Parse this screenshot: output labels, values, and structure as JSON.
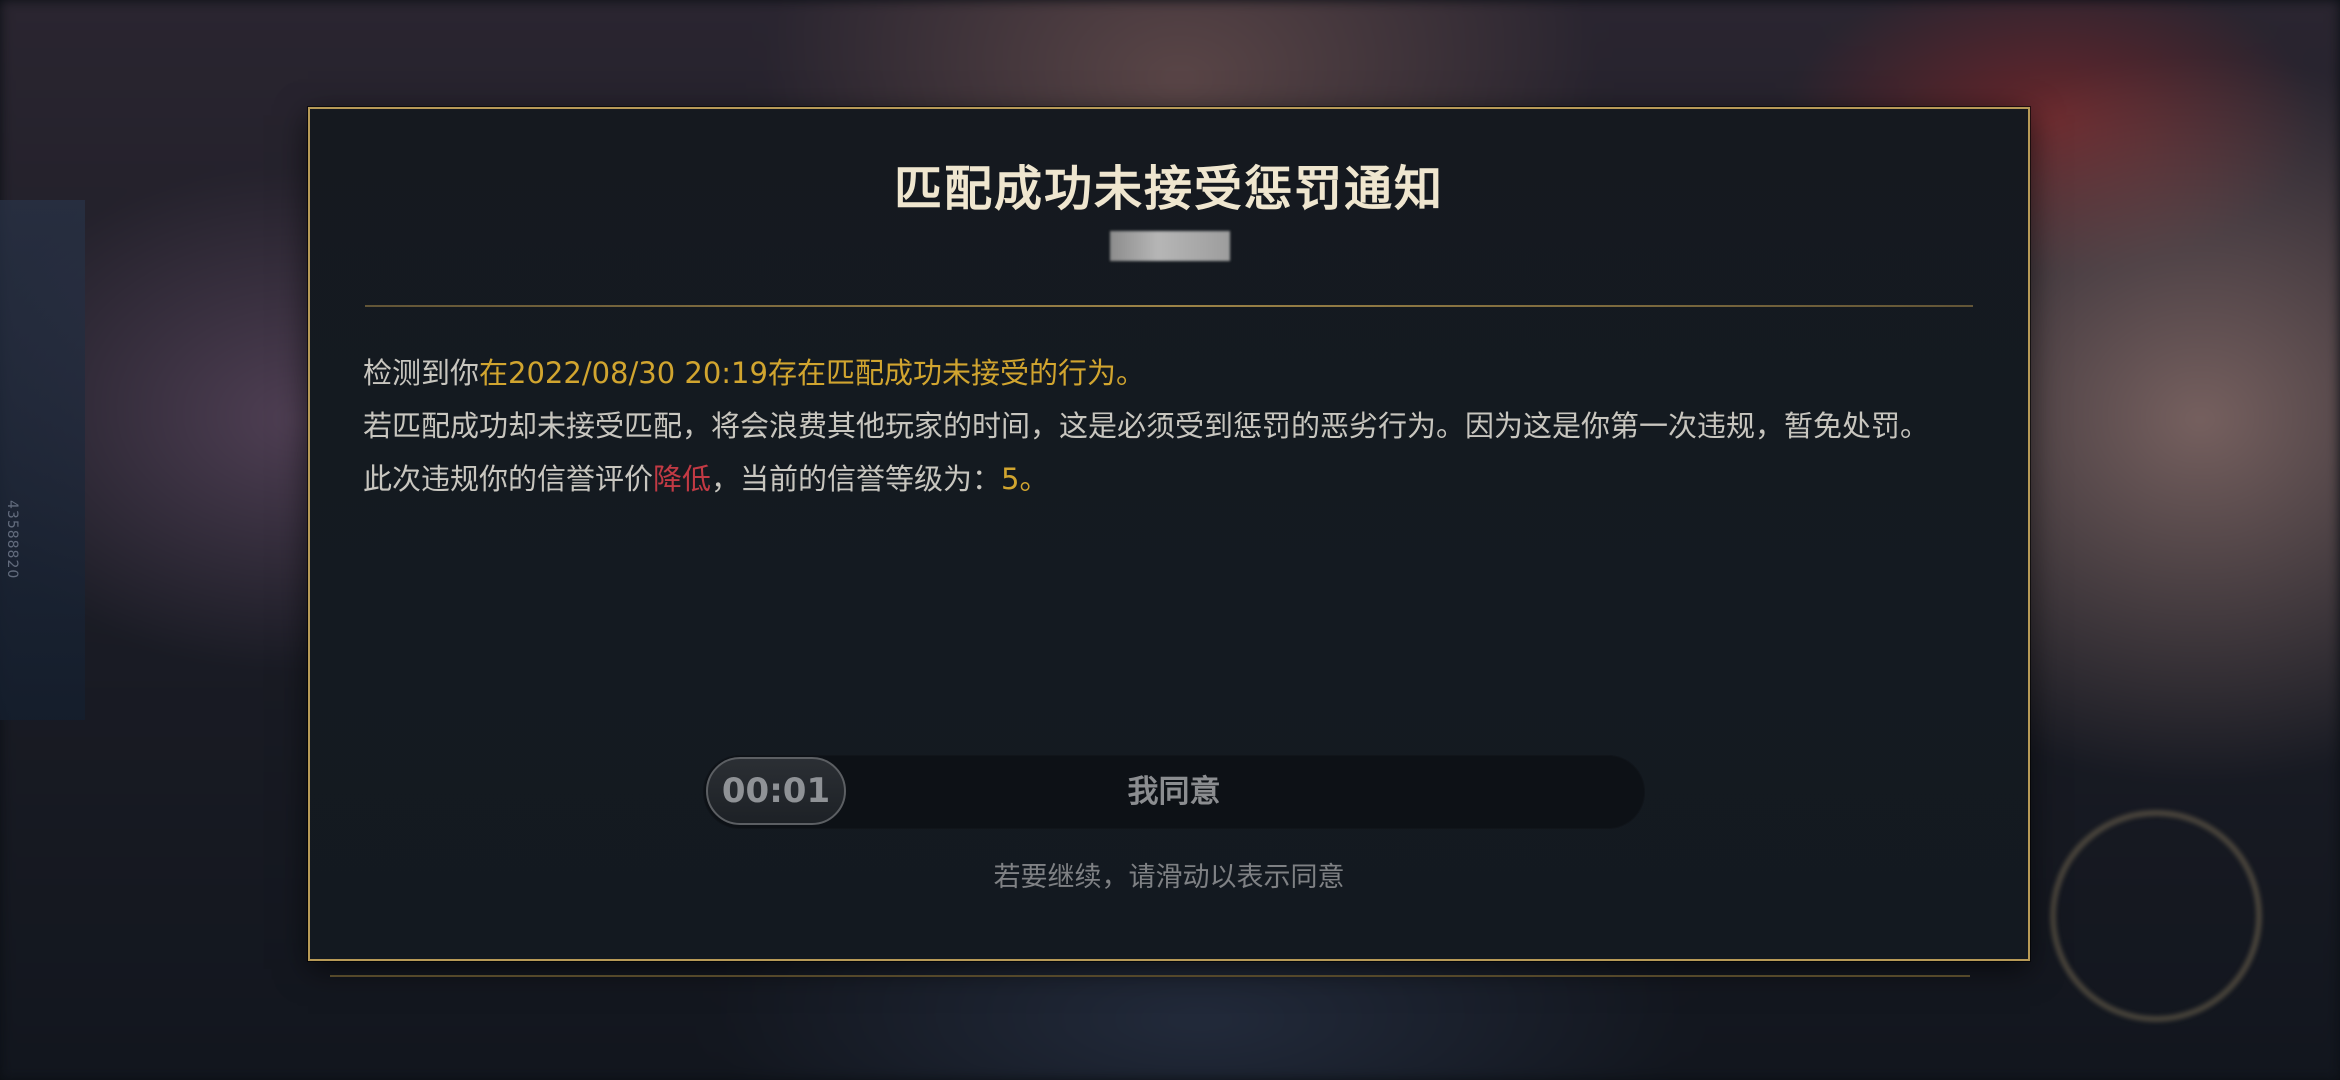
{
  "background": {
    "side_text": "43588820"
  },
  "dialog": {
    "title": "匹配成功未接受惩罚通知",
    "message": {
      "line1_prefix": "检测到你",
      "line1_highlight": "在2022/08/30 20:19存在匹配成功未接受的行为。",
      "line2": "若匹配成功却未接受匹配，将会浪费其他玩家的时间，这是必须受到惩罚的恶劣行为。因为这是你第一次违规，暂免处罚。",
      "line3_prefix": "此次违规你的信誉评价",
      "line3_drop": "降低",
      "line3_mid": "，当前的信誉等级为：",
      "line3_level": "5。"
    },
    "slider": {
      "timer": "00:01",
      "label": "我同意"
    },
    "hint": "若要继续，请滑动以表示同意"
  },
  "colors": {
    "border_gold": "#b79a57",
    "highlight_gold": "#d1a52f",
    "highlight_red": "#c23a44",
    "panel_bg": "#15191f"
  }
}
